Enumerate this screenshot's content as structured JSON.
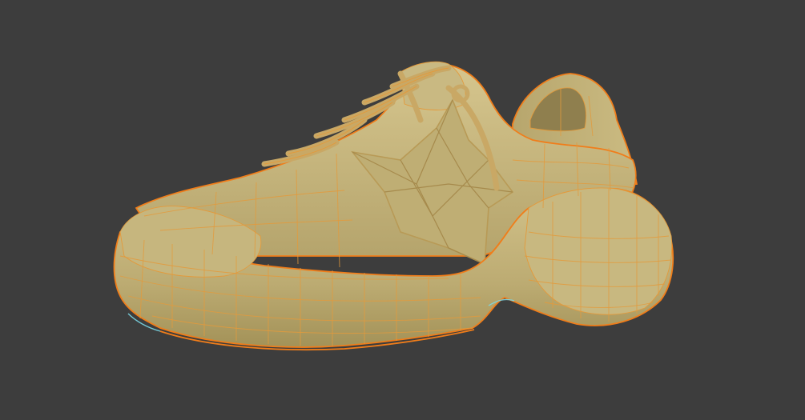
{
  "viewport": {
    "background_color": "#3d3d3d",
    "object_base_color": "#c3b27a",
    "object_shadow_color": "#9c8c5a",
    "object_highlight_color": "#d8c892",
    "selection_outline_color": "#f07d1a",
    "wireframe_color": "#e39a3c",
    "active_edge_color": "#7ad7e6",
    "object_name": "sneaker-mesh",
    "shading_mode": "solid",
    "overlay": "wireframe"
  }
}
